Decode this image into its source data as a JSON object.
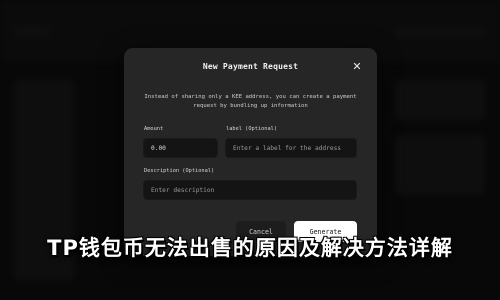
{
  "modal": {
    "title": "New Payment Request",
    "close_icon": "close-icon",
    "description": "Instead of sharing only a KEE address, you can create a payment request by bundling up information",
    "amount": {
      "label": "Amount",
      "value": "0.00"
    },
    "label_field": {
      "label": "label (Optional)",
      "placeholder": "Enter a label for the address"
    },
    "description_field": {
      "label": "Description (Optional)",
      "placeholder": "Enter description"
    },
    "cancel_label": "Cancel",
    "generate_label": "Generate"
  },
  "overlay": {
    "title": "TP钱包币无法出售的原因及解决方法详解"
  },
  "colors": {
    "modal_bg": "#262626",
    "field_bg": "#141414",
    "generate_bg": "#ffffff"
  }
}
